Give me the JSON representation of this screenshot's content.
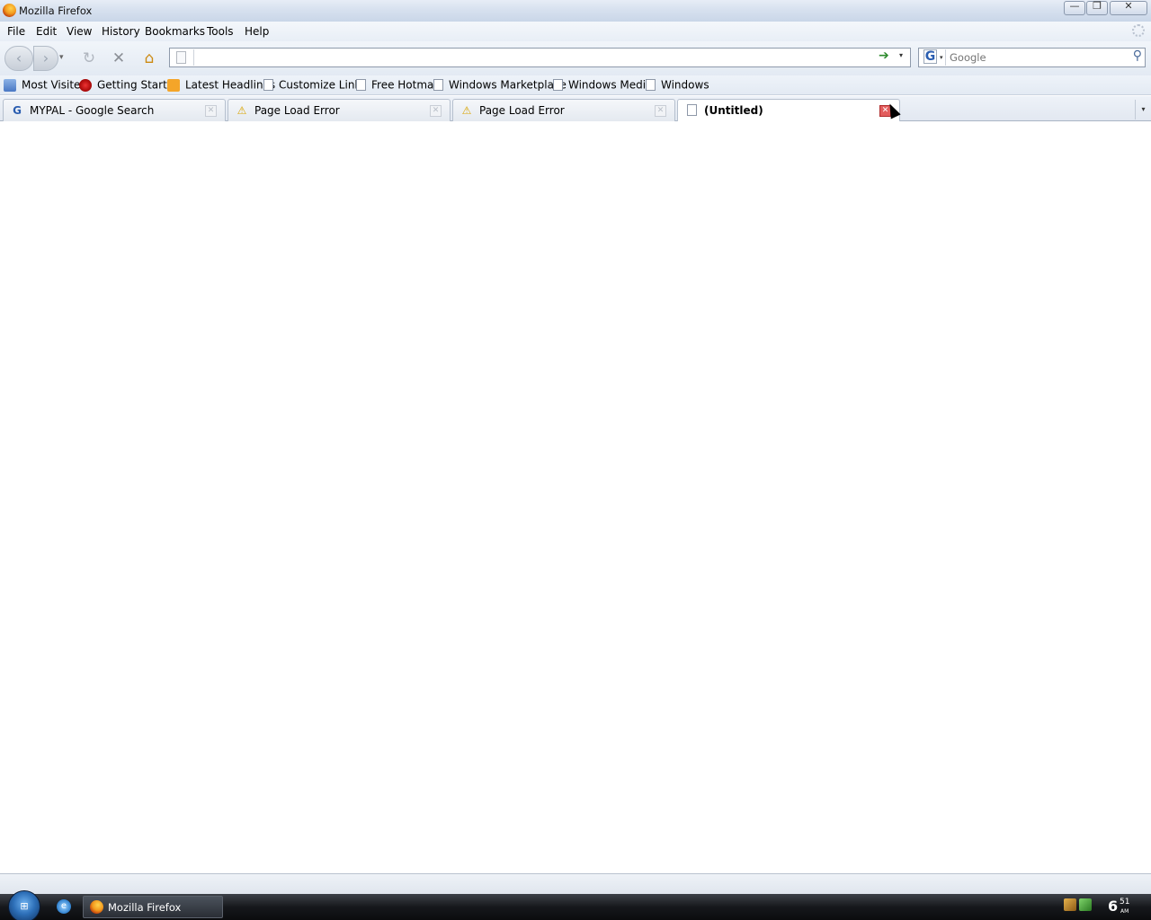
{
  "window": {
    "title": "Mozilla Firefox",
    "min_label": "—",
    "max_label": "❐",
    "close_label": "✕"
  },
  "menu": [
    "File",
    "Edit",
    "View",
    "History",
    "Bookmarks",
    "Tools",
    "Help"
  ],
  "nav": {
    "back_glyph": "‹",
    "forward_glyph": "›",
    "history_dropdown_glyph": "▾",
    "reload_glyph": "↻",
    "stop_glyph": "✕",
    "home_glyph": "⌂",
    "url_value": "",
    "go_glyph": "➔",
    "url_dropdown_glyph": "▾",
    "search_engine_glyph": "G",
    "search_engine_dd_glyph": "▾",
    "search_placeholder": "Google",
    "search_go_glyph": "⚲"
  },
  "bookmarks": [
    {
      "label": "Most Visited",
      "icon": "folder-icon"
    },
    {
      "label": "Getting Started",
      "icon": "firefox-icon"
    },
    {
      "label": "Latest Headlines",
      "icon": "rss-icon"
    },
    {
      "label": "Customize Links",
      "icon": "page-icon"
    },
    {
      "label": "Free Hotmail",
      "icon": "page-icon"
    },
    {
      "label": "Windows Marketplace",
      "icon": "page-icon"
    },
    {
      "label": "Windows Media",
      "icon": "page-icon"
    },
    {
      "label": "Windows",
      "icon": "page-icon"
    }
  ],
  "tabs": [
    {
      "label": "MYPAL - Google Search",
      "icon": "google-icon",
      "icon_glyph": "G",
      "selected": false
    },
    {
      "label": "Page Load Error",
      "icon": "warning-icon",
      "icon_glyph": "⚠",
      "selected": false
    },
    {
      "label": "Page Load Error",
      "icon": "warning-icon",
      "icon_glyph": "⚠",
      "selected": false
    },
    {
      "label": "(Untitled)",
      "icon": "page-icon",
      "icon_glyph": "",
      "selected": true
    }
  ],
  "tab_close_glyph": "✕",
  "tab_list_glyph": "▾",
  "taskbar": {
    "start_glyph": "⊞",
    "ie_glyph": "e",
    "firefox_task_label": "Mozilla Firefox",
    "clock_hour": "6",
    "clock_minutes": "51",
    "clock_ampm": "AM"
  },
  "colors": {
    "selected_tab_close": "#e35d5d",
    "taskbar": "#16181c"
  }
}
